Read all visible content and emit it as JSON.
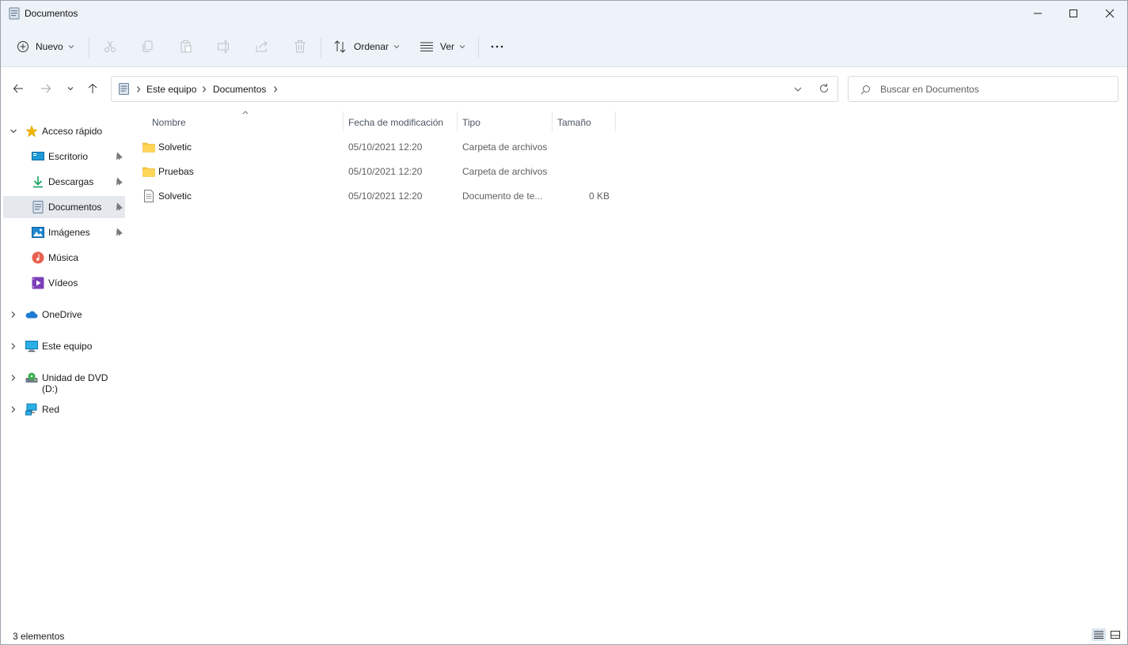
{
  "window": {
    "title": "Documentos",
    "controls": [
      "minimize",
      "maximize",
      "close"
    ]
  },
  "toolbar": {
    "new_label": "Nuevo",
    "sort_label": "Ordenar",
    "view_label": "Ver",
    "more_label": "···",
    "icons": [
      "plus-circle-icon",
      "cut-icon",
      "copy-icon",
      "paste-icon",
      "rename-icon",
      "share-icon",
      "delete-icon",
      "sort-icon",
      "view-icon",
      "more-icon"
    ]
  },
  "address": {
    "crumbs": [
      "Este equipo",
      "Documentos"
    ]
  },
  "search": {
    "placeholder": "Buscar en Documentos"
  },
  "sidebar": {
    "quick_access": "Acceso rápido",
    "items": [
      {
        "label": "Escritorio",
        "icon": "desktop-icon",
        "pinned": true
      },
      {
        "label": "Descargas",
        "icon": "download-icon",
        "pinned": true
      },
      {
        "label": "Documentos",
        "icon": "documents-icon",
        "pinned": true,
        "selected": true
      },
      {
        "label": "Imágenes",
        "icon": "pictures-icon",
        "pinned": true
      },
      {
        "label": "Música",
        "icon": "music-icon",
        "pinned": false
      },
      {
        "label": "Vídeos",
        "icon": "videos-icon",
        "pinned": false
      }
    ],
    "roots": [
      {
        "label": "OneDrive",
        "icon": "onedrive-icon"
      },
      {
        "label": "Este equipo",
        "icon": "pc-icon"
      },
      {
        "label": "Unidad de DVD (D:)",
        "icon": "dvd-icon"
      },
      {
        "label": "Red",
        "icon": "network-icon"
      }
    ]
  },
  "columns": {
    "name": "Nombre",
    "date": "Fecha de modificación",
    "type": "Tipo",
    "size": "Tamaño"
  },
  "files": [
    {
      "name": "Solvetic",
      "date": "05/10/2021 12:20",
      "type": "Carpeta de archivos",
      "size": "",
      "icon": "folder-icon"
    },
    {
      "name": "Pruebas",
      "date": "05/10/2021 12:20",
      "type": "Carpeta de archivos",
      "size": "",
      "icon": "folder-icon"
    },
    {
      "name": "Solvetic",
      "date": "05/10/2021 12:20",
      "type": "Documento de te...",
      "size": "0 KB",
      "icon": "text-file-icon"
    }
  ],
  "status": {
    "count": "3 elementos"
  },
  "colors": {
    "chrome": "#eef3f9",
    "accent": "#0067c0",
    "folder": "#f8c93a",
    "star": "#f2b600"
  }
}
